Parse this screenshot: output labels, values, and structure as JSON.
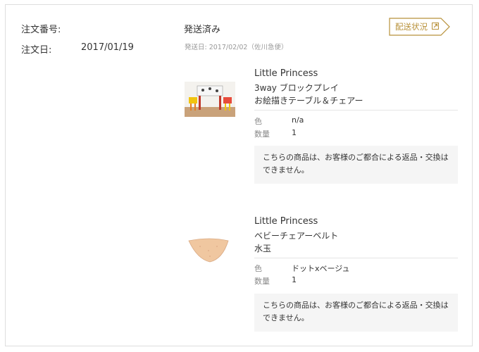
{
  "order": {
    "number_label": "注文番号:",
    "number_value": "",
    "date_label": "注文日:",
    "date_value": "2017/01/19"
  },
  "shipment": {
    "status": "発送済み",
    "meta": "発送日: 2017/02/02（佐川急便）",
    "track_button_label": "配送状況",
    "accent_color": "#b8913a"
  },
  "items": [
    {
      "brand": "Little Princess",
      "name_line1": "3way ブロックプレイ",
      "name_line2": "お絵描きテーブル＆チェアー",
      "attr1_key": "色",
      "attr1_value": "n/a",
      "attr2_key": "数量",
      "attr2_value": "1",
      "notice": "こちらの商品は、お客様のご都合による返品・交換はできません。"
    },
    {
      "brand": "Little Princess",
      "name_line1": "ベビーチェアーベルト",
      "name_line2": "水玉",
      "attr1_key": "色",
      "attr1_value": "ドットxベージュ",
      "attr2_key": "数量",
      "attr2_value": "1",
      "notice": "こちらの商品は、お客様のご都合による返品・交換はできません。"
    }
  ]
}
